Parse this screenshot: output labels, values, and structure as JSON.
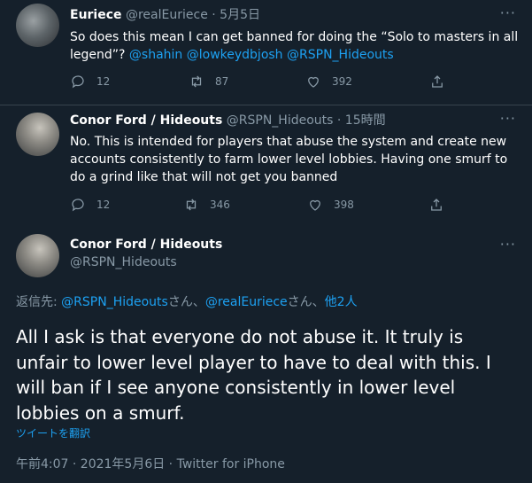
{
  "tweets": [
    {
      "name": "Euriece",
      "handle": "@realEuriece",
      "sep": "·",
      "time": "5月5日",
      "text_plain": "So does this mean I can get banned for doing the “Solo to masters in all legend”? ",
      "mentions": [
        "@shahin",
        "@lowkeydbjosh",
        "@RSPN_Hideouts"
      ],
      "reply_count": "12",
      "retweet_count": "87",
      "like_count": "392"
    },
    {
      "name": "Conor Ford / Hideouts",
      "handle": "@RSPN_Hideouts",
      "sep": "·",
      "time": "15時間",
      "text": "No. This is intended for players that abuse the system and create new accounts consistently to farm lower level lobbies. Having one smurf to do a grind like that will not get you banned",
      "reply_count": "12",
      "retweet_count": "346",
      "like_count": "398"
    }
  ],
  "focused": {
    "name": "Conor Ford / Hideouts",
    "handle": "@RSPN_Hideouts",
    "reply_prefix": "返信先: ",
    "reply_mention1": "@RSPN_Hideouts",
    "reply_san1": "さん、",
    "reply_mention2": "@realEuriece",
    "reply_san2": "さん、",
    "reply_others": "他2人",
    "text": "All I ask is that everyone do not abuse it. It truly is unfair to lower level player to have to deal with this. I will ban if I see anyone consistently in lower level lobbies on a smurf.",
    "translate": "ツイートを翻訳",
    "meta": "午前4:07 · 2021年5月6日 · Twitter for iPhone"
  },
  "icons": {
    "more": "more-icon",
    "reply": "reply-icon",
    "retweet": "retweet-icon",
    "like": "like-icon",
    "share": "share-icon"
  },
  "colors": {
    "background": "#15202b",
    "muted": "#8899a6",
    "accent": "#1da1f2",
    "divider": "#38444d"
  }
}
